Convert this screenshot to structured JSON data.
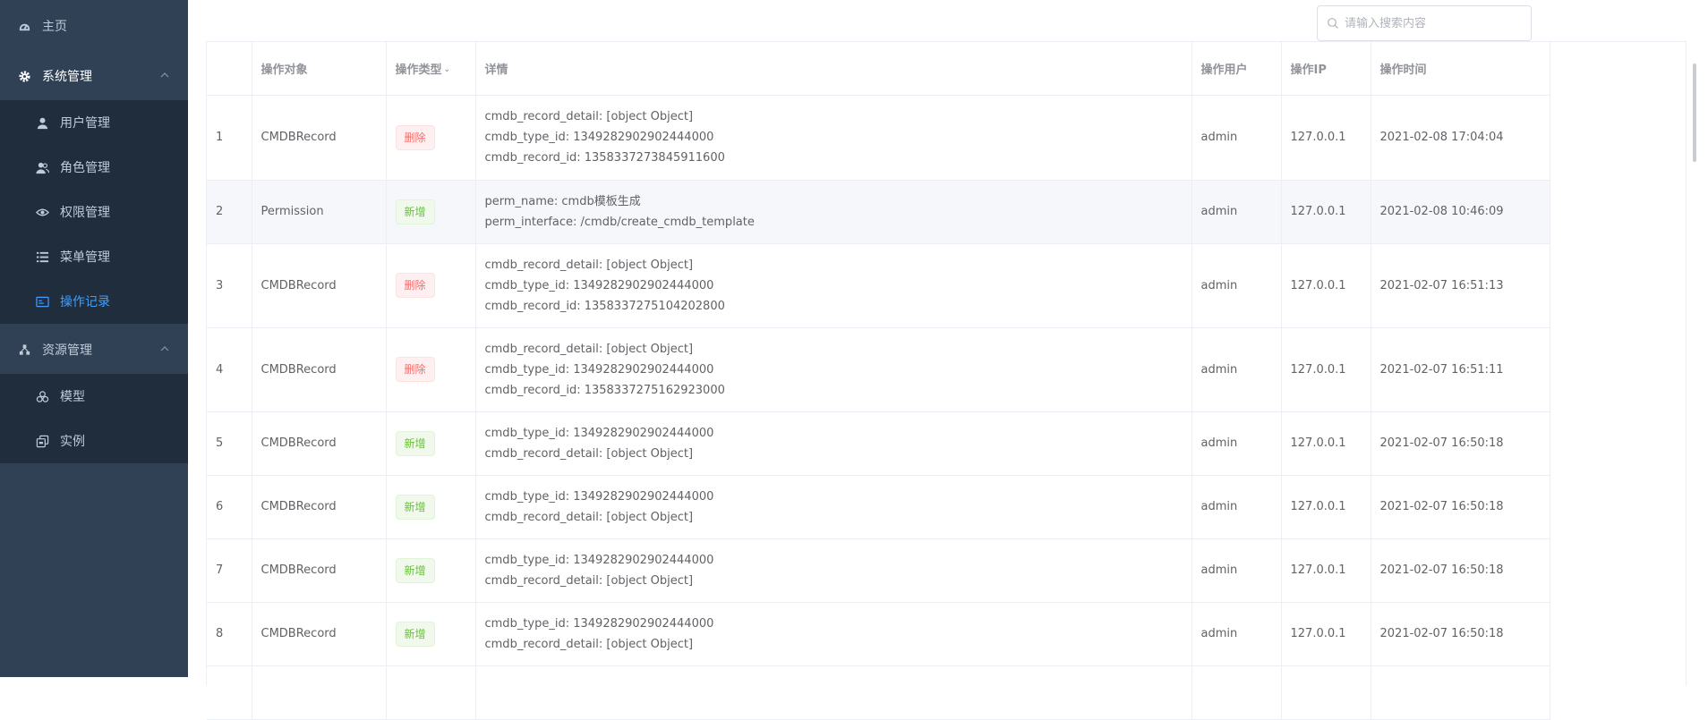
{
  "sidebar": {
    "home": "主页",
    "system_management": "系统管理",
    "system_items": [
      {
        "label": "用户管理",
        "icon": "user-icon"
      },
      {
        "label": "角色管理",
        "icon": "users-icon"
      },
      {
        "label": "权限管理",
        "icon": "eye-icon"
      },
      {
        "label": "菜单管理",
        "icon": "list-icon"
      },
      {
        "label": "操作记录",
        "icon": "record-icon",
        "active": true
      }
    ],
    "resource_management": "资源管理",
    "resource_items": [
      {
        "label": "模型",
        "icon": "model-icon"
      },
      {
        "label": "实例",
        "icon": "instance-icon"
      }
    ]
  },
  "search": {
    "placeholder": "请输入搜索内容"
  },
  "table": {
    "headers": [
      "",
      "操作对象",
      "操作类型",
      "详情",
      "操作用户",
      "操作IP",
      "操作时间"
    ],
    "rows": [
      {
        "no": "1",
        "object": "CMDBRecord",
        "type": "删除",
        "kind": "del",
        "details": [
          "cmdb_record_detail: [object Object]",
          "cmdb_type_id: 1349282902902444000",
          "cmdb_record_id: 1358337273845911600"
        ],
        "user": "admin",
        "ip": "127.0.0.1",
        "time": "2021-02-08 17:04:04"
      },
      {
        "no": "2",
        "object": "Permission",
        "type": "新增",
        "kind": "add",
        "details": [
          "perm_name: cmdb模板生成",
          "perm_interface: /cmdb/create_cmdb_template"
        ],
        "user": "admin",
        "ip": "127.0.0.1",
        "time": "2021-02-08 10:46:09"
      },
      {
        "no": "3",
        "object": "CMDBRecord",
        "type": "删除",
        "kind": "del",
        "details": [
          "cmdb_record_detail: [object Object]",
          "cmdb_type_id: 1349282902902444000",
          "cmdb_record_id: 1358337275104202800"
        ],
        "user": "admin",
        "ip": "127.0.0.1",
        "time": "2021-02-07 16:51:13"
      },
      {
        "no": "4",
        "object": "CMDBRecord",
        "type": "删除",
        "kind": "del",
        "details": [
          "cmdb_record_detail: [object Object]",
          "cmdb_type_id: 1349282902902444000",
          "cmdb_record_id: 1358337275162923000"
        ],
        "user": "admin",
        "ip": "127.0.0.1",
        "time": "2021-02-07 16:51:11"
      },
      {
        "no": "5",
        "object": "CMDBRecord",
        "type": "新增",
        "kind": "add",
        "details": [
          "cmdb_type_id: 1349282902902444000",
          "cmdb_record_detail: [object Object]"
        ],
        "user": "admin",
        "ip": "127.0.0.1",
        "time": "2021-02-07 16:50:18"
      },
      {
        "no": "6",
        "object": "CMDBRecord",
        "type": "新增",
        "kind": "add",
        "details": [
          "cmdb_type_id: 1349282902902444000",
          "cmdb_record_detail: [object Object]"
        ],
        "user": "admin",
        "ip": "127.0.0.1",
        "time": "2021-02-07 16:50:18"
      },
      {
        "no": "7",
        "object": "CMDBRecord",
        "type": "新增",
        "kind": "add",
        "details": [
          "cmdb_type_id: 1349282902902444000",
          "cmdb_record_detail: [object Object]"
        ],
        "user": "admin",
        "ip": "127.0.0.1",
        "time": "2021-02-07 16:50:18"
      },
      {
        "no": "8",
        "object": "CMDBRecord",
        "type": "新增",
        "kind": "add",
        "details": [
          "cmdb_type_id: 1349282902902444000",
          "cmdb_record_detail: [object Object]"
        ],
        "user": "admin",
        "ip": "127.0.0.1",
        "time": "2021-02-07 16:50:18"
      }
    ]
  },
  "colors": {
    "sidebar_bg": "#304156",
    "submenu_bg": "#1f2d3d",
    "accent": "#409eff",
    "danger": "#f56c6c",
    "success": "#67c23a"
  }
}
